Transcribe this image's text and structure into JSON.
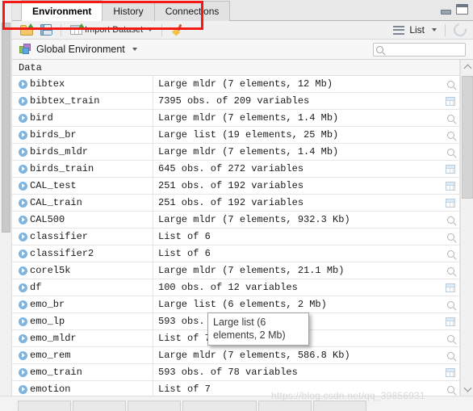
{
  "window": {
    "minimize_label": "minimize",
    "maximize_label": "maximize"
  },
  "tabs": [
    {
      "label": "Environment",
      "active": true
    },
    {
      "label": "History",
      "active": false
    },
    {
      "label": "Connections",
      "active": false
    }
  ],
  "toolbar": {
    "open_icon": "open-folder-icon",
    "save_icon": "save-disk-icon",
    "import_label": "Import Dataset",
    "import_icon": "table-import-icon",
    "clear_icon": "broom-icon",
    "view_mode_label": "List",
    "view_mode_icon": "list-lines-icon",
    "refresh_icon": "refresh-icon"
  },
  "environment": {
    "selector_label": "Global Environment",
    "selector_icon": "cube-icon",
    "search_value": "",
    "search_placeholder": "",
    "search_icon": "search-icon"
  },
  "grid": {
    "section_header": "Data",
    "rows": [
      {
        "name": "bibtex",
        "desc": "Large mldr (7 elements, 12 Mb)",
        "action": "magnifier"
      },
      {
        "name": "bibtex_train",
        "desc": "7395 obs. of 209 variables",
        "action": "table"
      },
      {
        "name": "bird",
        "desc": "Large mldr (7 elements, 1.4 Mb)",
        "action": "magnifier"
      },
      {
        "name": "birds_br",
        "desc": "Large list (19 elements, 25 Mb)",
        "action": "magnifier"
      },
      {
        "name": "birds_mldr",
        "desc": "Large mldr (7 elements, 1.4 Mb)",
        "action": "magnifier"
      },
      {
        "name": "birds_train",
        "desc": "645 obs. of 272 variables",
        "action": "table"
      },
      {
        "name": "CAL_test",
        "desc": "251 obs. of 192 variables",
        "action": "table"
      },
      {
        "name": "CAL_train",
        "desc": "251 obs. of 192 variables",
        "action": "table"
      },
      {
        "name": "CAL500",
        "desc": "Large mldr (7 elements, 932.3 Kb)",
        "action": "magnifier"
      },
      {
        "name": "classifier",
        "desc": "List of 6",
        "action": "magnifier"
      },
      {
        "name": "classifier2",
        "desc": "List of 6",
        "action": "magnifier"
      },
      {
        "name": "corel5k",
        "desc": "Large mldr (7 elements, 21.1 Mb)",
        "action": "magnifier"
      },
      {
        "name": "df",
        "desc": "100 obs. of 12 variables",
        "action": "table"
      },
      {
        "name": "emo_br",
        "desc": "Large list (6 elements, 2 Mb)",
        "action": "magnifier"
      },
      {
        "name": "emo_lp",
        "desc": "593 obs. of 78 variables",
        "action": "table"
      },
      {
        "name": "emo_mldr",
        "desc": "List of 7",
        "action": "magnifier"
      },
      {
        "name": "emo_rem",
        "desc": "Large mldr (7 elements, 586.8 Kb)",
        "action": "magnifier"
      },
      {
        "name": "emo_train",
        "desc": "593 obs. of 78 variables",
        "action": "table"
      },
      {
        "name": "emotion",
        "desc": "List of 7",
        "action": "magnifier"
      }
    ]
  },
  "tooltip": {
    "text": "Large list (6 elements, 2 Mb)"
  },
  "watermark": {
    "text": "https://blog.csdn.net/qq_39856931"
  },
  "annotation": {
    "color": "#f41a13"
  }
}
